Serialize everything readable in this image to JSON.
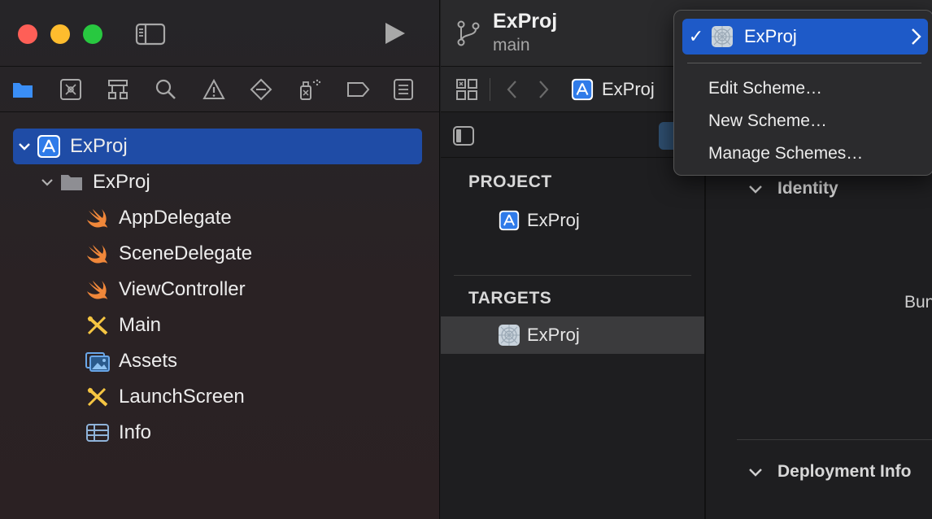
{
  "window": {
    "project_title": "ExProj",
    "branch": "main"
  },
  "navigator": {
    "tabs": [
      {
        "icon": "folder-icon"
      },
      {
        "icon": "source-control-icon"
      },
      {
        "icon": "symbol-hierarchy-icon"
      },
      {
        "icon": "search-icon"
      },
      {
        "icon": "warning-icon"
      },
      {
        "icon": "test-diamond-icon"
      },
      {
        "icon": "debug-spray-icon"
      },
      {
        "icon": "breakpoint-icon"
      },
      {
        "icon": "report-list-icon"
      }
    ],
    "tree": [
      {
        "label": "ExProj",
        "icon": "app-project-icon"
      },
      {
        "label": "ExProj",
        "icon": "folder-icon"
      },
      {
        "label": "AppDelegate",
        "icon": "swift-icon"
      },
      {
        "label": "SceneDelegate",
        "icon": "swift-icon"
      },
      {
        "label": "ViewController",
        "icon": "swift-icon"
      },
      {
        "label": "Main",
        "icon": "storyboard-icon"
      },
      {
        "label": "Assets",
        "icon": "asset-catalog-icon"
      },
      {
        "label": "LaunchScreen",
        "icon": "storyboard-icon"
      },
      {
        "label": "Info",
        "icon": "plist-table-icon"
      }
    ]
  },
  "jumpbar": {
    "label": "ExProj"
  },
  "project_list": {
    "project_header": "PROJECT",
    "project_item": "ExProj",
    "targets_header": "TARGETS",
    "target_item": "ExProj"
  },
  "inspector": {
    "identity_section": "Identity",
    "bundle_partial": "Bun",
    "deployment_section": "Deployment Info"
  },
  "scheme_menu": {
    "selected_scheme": "ExProj",
    "items": [
      "Edit Scheme…",
      "New Scheme…",
      "Manage Schemes…"
    ]
  },
  "colors": {
    "selection_blue": "#1f4ca6",
    "menu_highlight": "#1e5ac8",
    "accent_blue": "#3a8ef6",
    "swift_orange": "#f0873a"
  }
}
